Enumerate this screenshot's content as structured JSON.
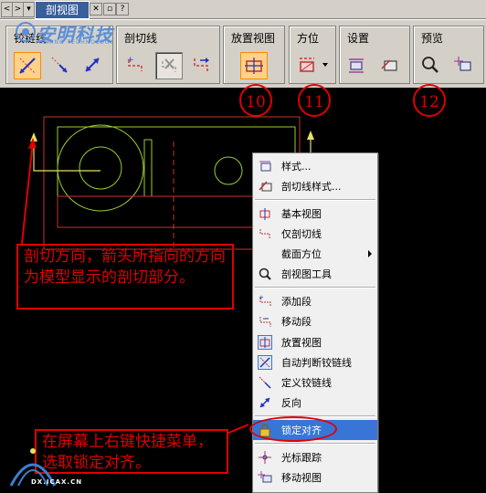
{
  "tabstrip": {
    "active_tab": "剖视图",
    "nav_left": "<",
    "nav_right": ">"
  },
  "watermark": {
    "name": "安明科技",
    "sub": "ANMING TECHNOLOGY",
    "color": "#5a8fd8"
  },
  "toolbar": {
    "groups": [
      {
        "label": "铰链线",
        "buttons": [
          "hinge-line-auto-icon",
          "hinge-line-define-icon",
          "reverse-direction-icon"
        ]
      },
      {
        "label": "剖切线",
        "buttons": [
          "add-segment-icon",
          "delete-segment-icon",
          "move-segment-icon"
        ]
      },
      {
        "label": "放置视图",
        "buttons": [
          "place-view-icon"
        ]
      },
      {
        "label": "方位",
        "buttons": [
          "section-orientation-icon"
        ]
      },
      {
        "label": "设置",
        "buttons": [
          "style-settings-icon",
          "section-line-style-icon"
        ]
      },
      {
        "label": "预览",
        "buttons": [
          "preview-icon",
          "move-view-icon"
        ]
      }
    ]
  },
  "callouts": [
    "10",
    "11",
    "12"
  ],
  "notes": {
    "note1": "剖切方向，箭头所指向的方向为模型显示的剖切部分。",
    "note2": "在屏幕上右键快捷菜单，选取锁定对齐。"
  },
  "menu": {
    "items": [
      {
        "label": "样式...",
        "icon": "style-icon"
      },
      {
        "label": "剖切线样式...",
        "icon": "section-line-style-icon"
      },
      {
        "label": "基本视图",
        "icon": "base-view-icon"
      },
      {
        "label": "仅剖切线",
        "icon": "section-line-only-icon"
      },
      {
        "label": "截面方位",
        "icon": "",
        "submenu": true
      },
      {
        "label": "剖视图工具",
        "icon": "section-view-tool-icon"
      },
      {
        "label": "添加段",
        "icon": "add-segment-icon"
      },
      {
        "label": "移动段",
        "icon": "move-segment-icon"
      },
      {
        "label": "放置视图",
        "icon": "place-view-icon",
        "checked": true
      },
      {
        "label": "自动判断铰链线",
        "icon": "auto-hinge-line-icon",
        "checked": true
      },
      {
        "label": "定义铰链线",
        "icon": "define-hinge-line-icon"
      },
      {
        "label": "反向",
        "icon": "reverse-icon"
      },
      {
        "label": "锁定对齐",
        "icon": "lock-icon",
        "selected": true
      },
      {
        "label": "光标跟踪",
        "icon": "cursor-tracking-icon"
      },
      {
        "label": "移动视图",
        "icon": "move-view-icon"
      }
    ]
  },
  "bottom_logo": {
    "text": "DX.ICAX.CN"
  },
  "colors": {
    "callout_red": "#e00000",
    "drawing_green": "#9acd32",
    "drawing_red": "#c83232",
    "arrow_yellow": "#e8e060",
    "menu_highlight": "#3875d7"
  }
}
